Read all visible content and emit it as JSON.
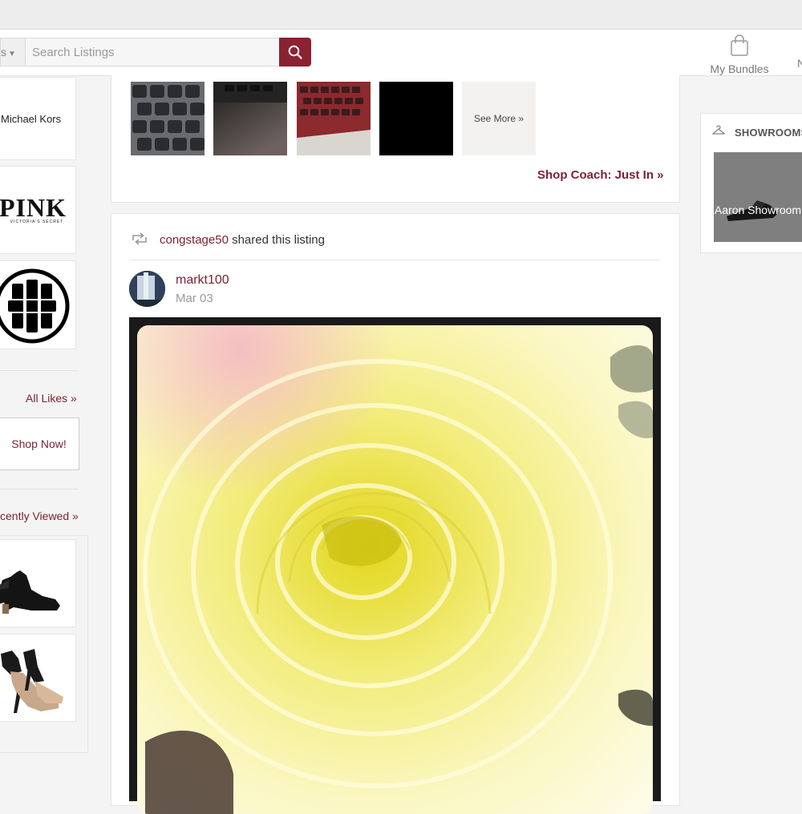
{
  "header": {
    "scope_label": "s",
    "search_placeholder": "Search Listings",
    "bundles_label": "My Bundles",
    "next_nav_partial": "N"
  },
  "left_sidebar": {
    "brands": [
      {
        "label": "Michael Kors"
      },
      {
        "label": "PINK",
        "sublabel": "VICTORIA'S SECRET"
      },
      {
        "label": "Tory Burch logo"
      }
    ],
    "all_likes_link": "All Likes »",
    "shop_now_button": "Shop Now!",
    "recently_viewed_link": "cently Viewed »",
    "recently_viewed_items": [
      {
        "icon": "black-ankle-boot"
      },
      {
        "icon": "nude-black-heel-sandal"
      }
    ]
  },
  "feed": {
    "thumbnails": [
      {
        "icon": "keyboard-keys-photo"
      },
      {
        "icon": "laptop-dark-photo"
      },
      {
        "icon": "red-keyboard-photo"
      },
      {
        "icon": "black-photo"
      }
    ],
    "see_more_label": "See More »",
    "shop_link": "Shop Coach: Just In »",
    "share": {
      "sharer": "congstage50",
      "action_text": " shared this listing"
    },
    "post": {
      "author": "markt100",
      "date": "Mar 03",
      "image_icon": "yellow-ranunculus-flower-photo"
    }
  },
  "right_sidebar": {
    "section_title": "SHOWROOMS",
    "showroom_label": "Aaron Showroom"
  },
  "colors": {
    "brand": "#8a2232",
    "link": "#7d2233"
  }
}
